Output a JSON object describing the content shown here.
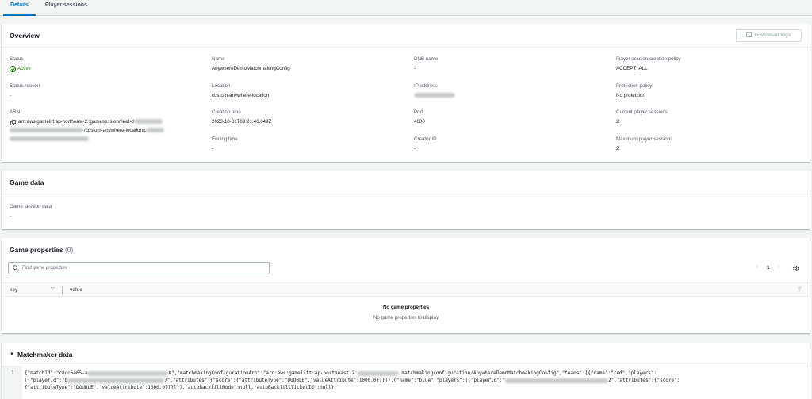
{
  "tabs": [
    {
      "label": "Details",
      "active": true
    },
    {
      "label": "Player sessions",
      "active": false
    }
  ],
  "overview": {
    "title": "Overview",
    "download_logs_label": "Download logs",
    "col1": {
      "status_label": "Status",
      "status_value": "Active",
      "status_reason_label": "Status reason",
      "status_reason_value": "-",
      "arn_label": "ARN",
      "arn_line1": "arn:aws:gamelift:ap-northeast-2::gamesession/fleet-d",
      "arn_line2": "/custom-anywhere-location/c"
    },
    "col2": {
      "name_label": "Name",
      "name_value": "AnywhereDemoMatchmakingConfig",
      "location_label": "Location",
      "location_value": "custom-anywhere-location",
      "creation_time_label": "Creation time",
      "creation_time_value": "2023-10-31T09:21:46.649Z",
      "ending_time_label": "Ending time",
      "ending_time_value": "-"
    },
    "col3": {
      "dns_label": "DNS name",
      "dns_value": "-",
      "ip_label": "IP address",
      "port_label": "Port",
      "port_value": "4000",
      "creator_label": "Creator ID",
      "creator_value": "-"
    },
    "col4": {
      "policy_label": "Player session creation policy",
      "policy_value": "ACCEPT_ALL",
      "protection_label": "Protection policy",
      "protection_value": "No protection",
      "current_label": "Current player sessions",
      "current_value": "2",
      "max_label": "Maximum player sessions",
      "max_value": "2"
    }
  },
  "game_data": {
    "title": "Game data",
    "session_data_label": "Game session data",
    "session_data_value": "-"
  },
  "game_properties": {
    "title": "Game properties",
    "count": "(0)",
    "search_placeholder": "Find game properties",
    "page": "1",
    "col_key": "key",
    "col_value": "value",
    "empty_title": "No game properties",
    "empty_sub": "No game properties to display"
  },
  "matchmaker": {
    "title": "Matchmaker data",
    "line_no": "1",
    "l1a": "{\"matchId\":\"c8cc5e65-a",
    "l1b": "8\",\"matchmakingConfigurationArn\":\"arn:aws:gamelift:ap-northeast-2:",
    "l1c": ":matchmakingconfiguration/AnywhereDemoMatchmakingConfig\",\"teams\":[{\"name\":\"red\",\"players\":",
    "l2a": "[{\"playerId\":\"b",
    "l2b": "7\",\"attributes\":{\"score\":{\"attributeType\":\"DOUBLE\",\"valueAttribute\":1000.0}}}]},{\"name\":\"blue\",\"players\":[{\"playerId\":\"",
    "l2c": "2\",\"attributes\":{\"score\":",
    "l3": "{\"attributeType\":\"DOUBLE\",\"valueAttribute\":1000.0}}}]}],\"autoBackfillMode\":null,\"autoBackfillTicketId\":null}"
  }
}
